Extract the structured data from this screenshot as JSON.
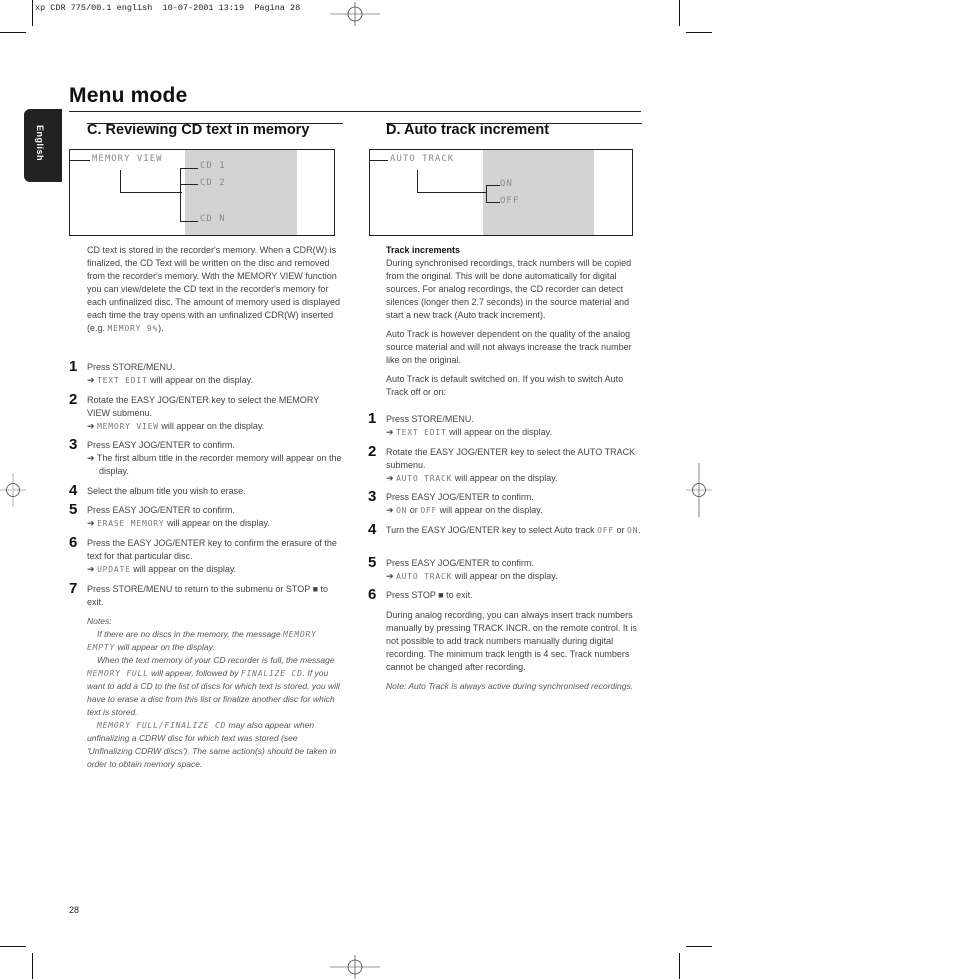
{
  "print_slug": "xp CDR 775/00.1 english  10-07-2001 13:19  Pagina 28",
  "page_title": "Menu mode",
  "language_tab": "English",
  "page_number": "28",
  "section_c": {
    "title": "C. Reviewing CD text in memory",
    "diagram": {
      "root": "MEMORY VIEW",
      "items": [
        "CD 1",
        "CD 2",
        "CD N"
      ]
    },
    "intro": "CD text is stored in the recorder's memory. When a CDR(W) is finalized, the CD Text will be written on the disc and removed from the recorder's memory. With the MEMORY VIEW function you can view/delete the CD text in the recorder's memory for each unfinalized disc. The amount of memory used is displayed each time the tray opens with an unfinalized CDR(W) inserted",
    "intro_example_prefix": "(e.g. ",
    "intro_example_lcd": "MEMORY 9%",
    "intro_example_suffix": ").",
    "steps": [
      {
        "n": "1",
        "text": "Press STORE/MENU.",
        "result_lcd": "TEXT EDIT",
        "result_text": " will appear on the display."
      },
      {
        "n": "2",
        "text": "Rotate the EASY JOG/ENTER key to select the MEMORY VIEW submenu.",
        "result_lcd": "MEMORY VIEW",
        "result_text": " will appear on the display."
      },
      {
        "n": "3",
        "text": "Press EASY JOG/ENTER to confirm.",
        "result_lcd": "",
        "result_text": "The first album title in the recorder memory will appear on the display."
      },
      {
        "n": "4",
        "text": "Select the album title you wish to erase.",
        "result_lcd": "",
        "result_text": ""
      },
      {
        "n": "5",
        "text": "Press EASY JOG/ENTER to confirm.",
        "result_lcd": "ERASE MEMORY",
        "result_text": " will appear on the display."
      },
      {
        "n": "6",
        "text": "Press the EASY JOG/ENTER key to confirm the erasure of the text for that particular disc.",
        "result_lcd": "UPDATE",
        "result_text": " will appear on the display."
      },
      {
        "n": "7",
        "text": "Press STORE/MENU to return to the submenu or STOP ■ to exit.",
        "result_lcd": "",
        "result_text": ""
      }
    ],
    "notes": {
      "heading": "Notes:",
      "note1_a": "If there are no discs in the memory, the message ",
      "note1_lcd": "MEMORY EMPTY",
      "note1_b": " will appear on the display.",
      "note2_a": "When the text memory of your CD recorder is full, the message ",
      "note2_lcd1": "MEMORY FULL",
      "note2_b": " will appear, followed by ",
      "note2_lcd2": "FINALIZE CD",
      "note2_c": ". If you want to add a CD to the list of discs for which text is stored, you will have to erase a disc from this list or finalize another disc for which text is stored.",
      "note3_lcd": "MEMORY FULL/FINALIZE CD",
      "note3_b": " may also appear when unfinalizing a CDRW disc for which text was stored (see 'Unfinalizing CDRW discs'). The same action(s) should be taken in order to obtain memory space."
    }
  },
  "section_d": {
    "title": "D. Auto track increment",
    "diagram": {
      "root": "AUTO TRACK",
      "items": [
        "ON",
        "OFF"
      ]
    },
    "subheading": "Track increments",
    "para1": "During synchronised recordings, track numbers will be copied from the original. This will be done automatically for digital sources. For analog recordings, the CD recorder can detect silences (longer then 2.7 seconds) in the source material and start a new track (Auto track increment).",
    "para2": "Auto Track is however dependent on the quality of the analog source material and will not always increase the track number like on the original.",
    "para3": "Auto Track is default switched on. If you wish to switch Auto Track off or on:",
    "steps": [
      {
        "n": "1",
        "text": "Press STORE/MENU.",
        "result_lcd": "TEXT EDIT",
        "result_text": " will appear on the display."
      },
      {
        "n": "2",
        "text": "Rotate the EASY JOG/ENTER key to select the AUTO TRACK submenu.",
        "result_lcd": "AUTO TRACK",
        "result_text": " will appear on the display."
      },
      {
        "n": "3",
        "text": "Press EASY JOG/ENTER to confirm.",
        "result_lcd": "ON",
        "result_mid": " or ",
        "result_lcd2": "OFF",
        "result_text": " will appear on the display."
      },
      {
        "n": "4",
        "text_a": "Turn the EASY JOG/ENTER key to select Auto track ",
        "lcd_a": "OFF",
        "text_b": " or ",
        "lcd_b": "ON",
        "text_c": "."
      },
      {
        "n": "5",
        "text": "Press EASY JOG/ENTER to confirm.",
        "result_lcd": "AUTO TRACK",
        "result_text": " will appear on the display."
      },
      {
        "n": "6",
        "text": "Press STOP ■  to exit."
      }
    ],
    "para4": "During analog recording, you can always insert track numbers manually by pressing TRACK INCR. on the remote control. It is not possible to add track numbers manually during digital recording. The minimum track length is 4 sec. Track numbers cannot be changed after recording.",
    "note": "Note: Auto Track is always active during synchronised recordings."
  },
  "arrow_glyph": "➔"
}
